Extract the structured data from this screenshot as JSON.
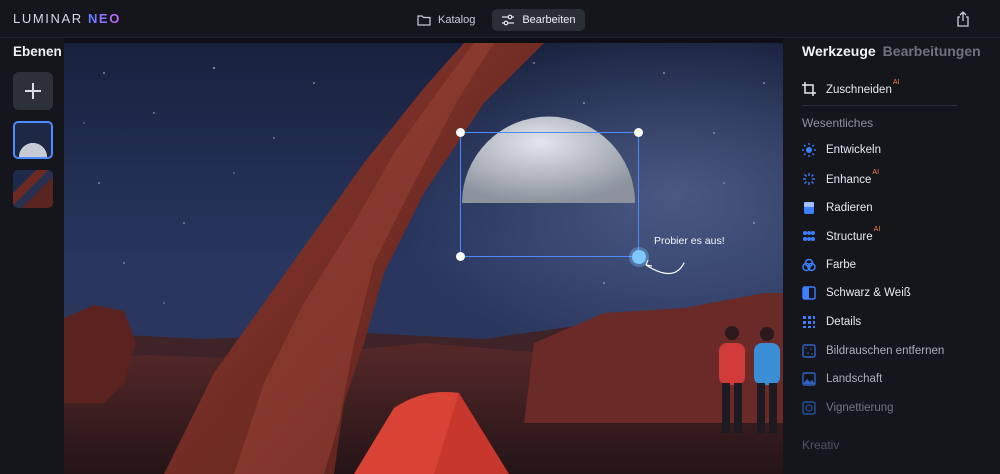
{
  "app": {
    "logo_text": "LUMINAR",
    "logo_accent": "NEO"
  },
  "header": {
    "tabs": [
      {
        "label": "Katalog",
        "icon": "folder-icon",
        "active": false
      },
      {
        "label": "Bearbeiten",
        "icon": "sliders-icon",
        "active": true
      }
    ],
    "share_icon": "share-icon"
  },
  "layers": {
    "title": "Ebenen"
  },
  "canvas": {
    "hint_text": "Probier es aus!"
  },
  "tools_panel": {
    "tabs": [
      {
        "label": "Werkzeuge",
        "active": true
      },
      {
        "label": "Bearbeitungen",
        "active": false
      }
    ],
    "crop": {
      "label": "Zuschneiden",
      "ai": "AI"
    },
    "sections": {
      "essentials": "Wesentliches",
      "creative": "Kreativ"
    },
    "items": [
      {
        "label": "Entwickeln",
        "ai": ""
      },
      {
        "label": "Enhance",
        "ai": "AI"
      },
      {
        "label": "Radieren",
        "ai": ""
      },
      {
        "label": "Structure",
        "ai": "AI"
      },
      {
        "label": "Farbe",
        "ai": ""
      },
      {
        "label": "Schwarz & Weiß",
        "ai": ""
      },
      {
        "label": "Details",
        "ai": ""
      },
      {
        "label": "Bildrauschen entfernen",
        "ai": ""
      },
      {
        "label": "Landschaft",
        "ai": ""
      },
      {
        "label": "Vignettierung",
        "ai": ""
      }
    ]
  },
  "colors": {
    "accent_blue": "#4d8bff",
    "ai_badge": "#ff7a4a",
    "icon_blue": "#3d7fff"
  }
}
